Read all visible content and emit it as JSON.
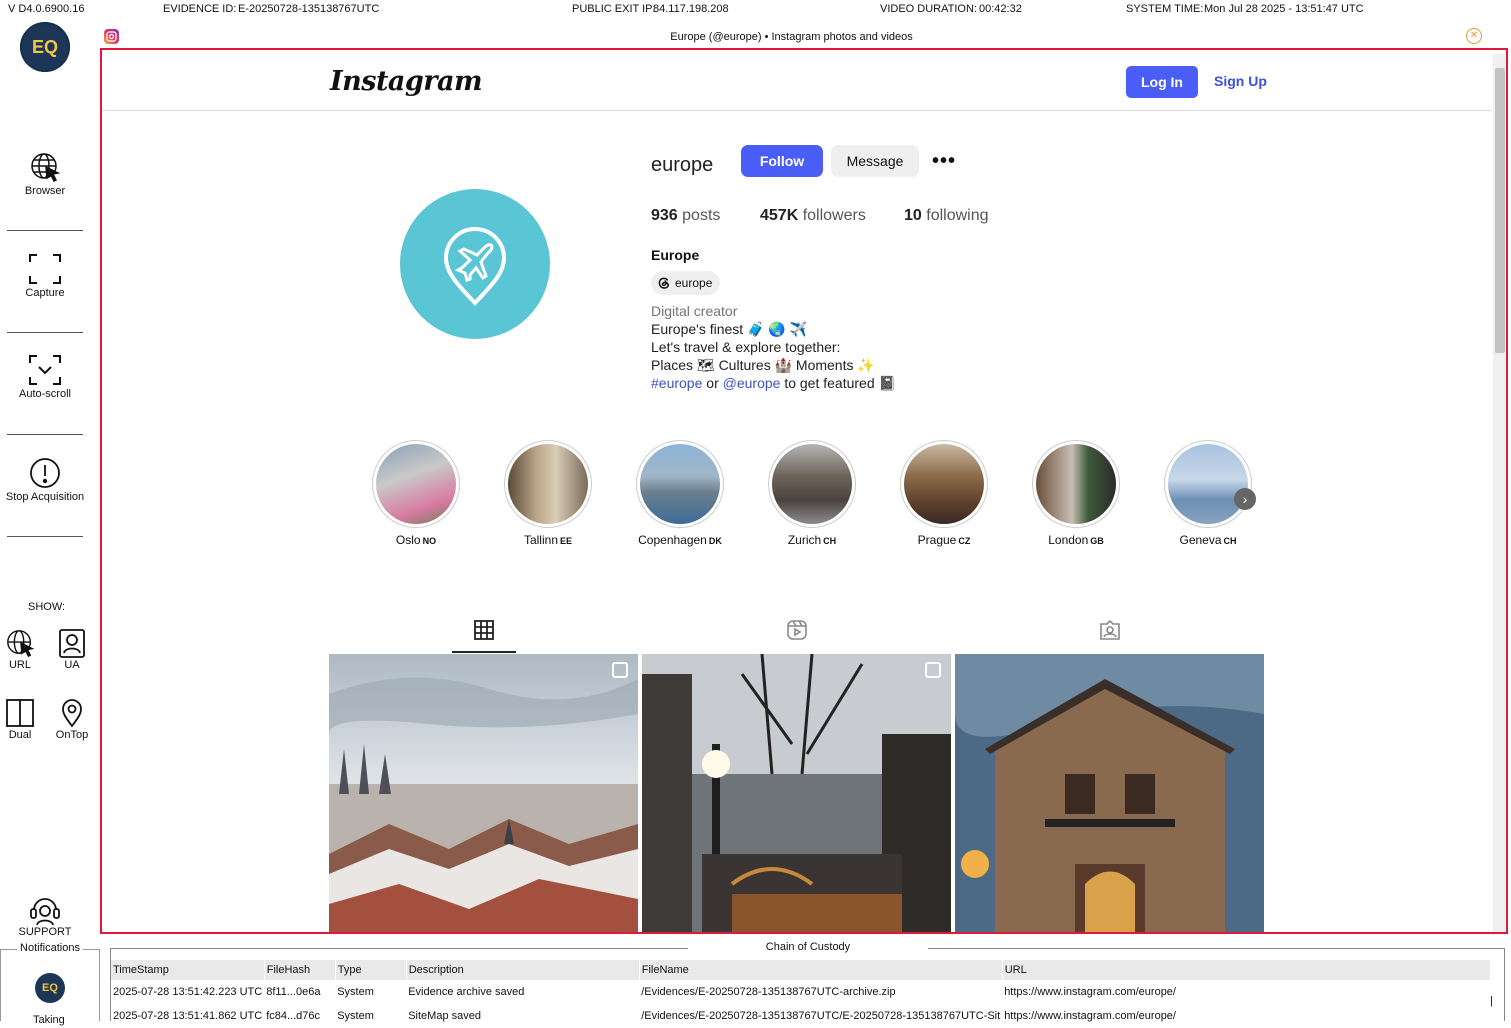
{
  "topbar": {
    "version": "V D4.0.6900.16",
    "evidence_label": "EVIDENCE ID:",
    "evidence_value": "E-20250728-135138767UTC",
    "ip_label": "PUBLIC EXIT IP:",
    "ip_value": "84.117.198.208",
    "duration_label": "VIDEO DURATION:",
    "duration_value": "00:42:32",
    "time_label": "SYSTEM TIME:",
    "time_value": "Mon Jul 28 2025 - 13:51:47 UTC"
  },
  "sidebar": {
    "logo_text": "EQ",
    "tools": [
      {
        "label": "Browser",
        "icon": "globe-cursor-icon"
      },
      {
        "label": "Capture",
        "icon": "capture-frame-icon"
      },
      {
        "label": "Auto-scroll",
        "icon": "auto-scroll-icon"
      },
      {
        "label": "Stop Acquisition",
        "icon": "stop-alert-icon"
      }
    ],
    "show_label": "SHOW:",
    "show_items": [
      {
        "label": "URL",
        "icon": "globe-cursor-icon"
      },
      {
        "label": "UA",
        "icon": "user-badge-icon"
      },
      {
        "label": "Dual",
        "icon": "dual-pane-icon"
      },
      {
        "label": "OnTop",
        "icon": "pin-icon"
      }
    ],
    "support_label": "SUPPORT",
    "notifications_label": "Notifications",
    "taking_label": "Taking"
  },
  "window": {
    "title": "Europe (@europe) • Instagram photos and videos"
  },
  "instagram": {
    "brand": "Instagram",
    "login": "Log In",
    "signup": "Sign Up",
    "username": "europe",
    "follow": "Follow",
    "message": "Message",
    "more": "•••",
    "stats": {
      "posts_count": "936",
      "posts_label": "posts",
      "followers_count": "457K",
      "followers_label": "followers",
      "following_count": "10",
      "following_label": "following"
    },
    "full_name": "Europe",
    "threads_handle": "europe",
    "bio": {
      "category": "Digital creator",
      "line1": "Europe's finest 🧳 🌏 ✈️",
      "line2": "Let's travel & explore together:",
      "line3": "Places 🗺 Cultures 🏰 Moments ✨",
      "hashtag": "#europe",
      "or": " or ",
      "mention": "@europe",
      "line4_rest": " to get featured 📓"
    },
    "highlights": [
      {
        "name": "Oslo",
        "cc": "NO"
      },
      {
        "name": "Tallinn",
        "cc": "EE"
      },
      {
        "name": "Copenhagen",
        "cc": "DK"
      },
      {
        "name": "Zurich",
        "cc": "CH"
      },
      {
        "name": "Prague",
        "cc": "CZ"
      },
      {
        "name": "London",
        "cc": "GB"
      },
      {
        "name": "Geneva",
        "cc": "CH"
      }
    ],
    "tabs": [
      "grid-icon",
      "reels-icon",
      "tagged-icon"
    ]
  },
  "coc": {
    "title": "Chain of Custody",
    "headers": [
      "TimeStamp",
      "FileHash",
      "Type",
      "Description",
      "FileName",
      "URL"
    ],
    "rows": [
      [
        "2025-07-28 13:51:42.223 UTC",
        "8f11...0e6a",
        "System",
        "Evidence archive saved",
        "/Evidences/E-20250728-135138767UTC-archive.zip",
        "https://www.instagram.com/europe/"
      ],
      [
        "2025-07-28 13:51:41.862 UTC",
        "fc84...d76c",
        "System",
        "SiteMap saved",
        "/Evidences/E-20250728-135138767UTC/E-20250728-135138767UTC-Sit",
        "https://www.instagram.com/europe/"
      ]
    ]
  }
}
